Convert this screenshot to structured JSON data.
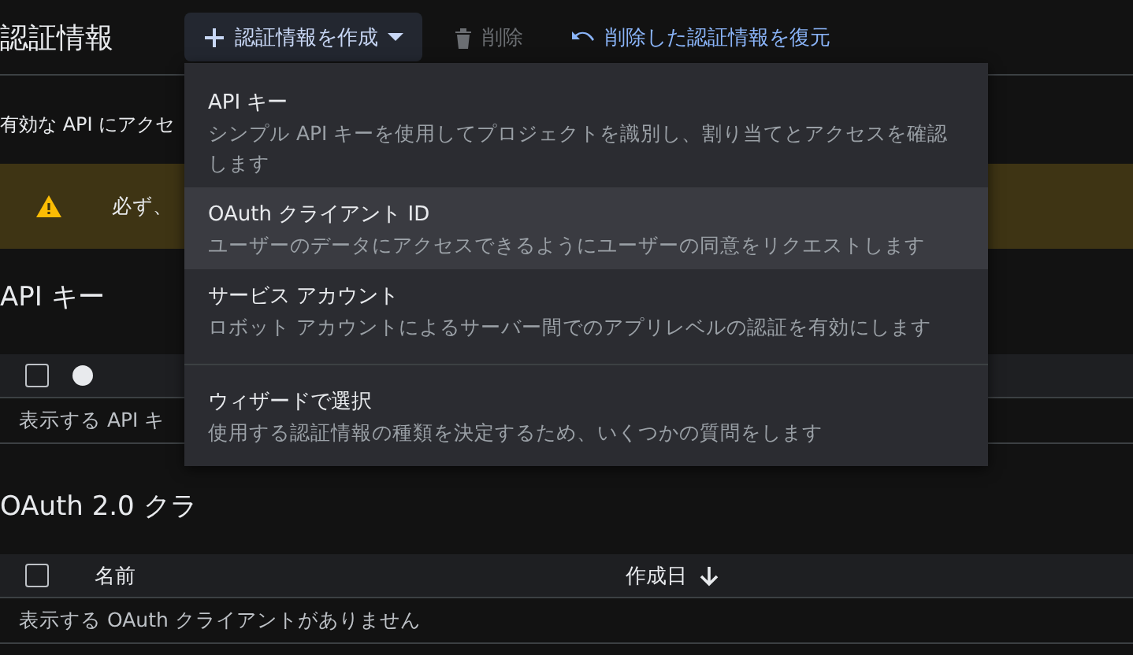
{
  "header": {
    "title": "認証情報",
    "create_button": "認証情報を作成",
    "delete_button": {
      "label": "削除",
      "disabled": true
    },
    "restore_link": "削除した認証情報を復元"
  },
  "intro": "有効な API にアクセ",
  "warning": "必ず、",
  "api_keys": {
    "heading": "API キー",
    "select_all_checked": false,
    "empty": "表示する API キ"
  },
  "oauth": {
    "heading": "OAuth 2.0 クラ",
    "select_all_checked": false,
    "columns": [
      "名前",
      "作成日"
    ],
    "empty": "表示する OAuth クライアントがありません"
  },
  "menu": {
    "items": [
      {
        "title": "API キー",
        "description": "シンプル API キーを使用してプロジェクトを識別し、割り当てとアクセスを確認します",
        "highlighted": false
      },
      {
        "title": "OAuth クライアント ID",
        "description": "ユーザーのデータにアクセスできるようにユーザーの同意をリクエストします",
        "highlighted": true
      },
      {
        "title": "サービス アカウント",
        "description": "ロボット アカウントによるサーバー間でのアプリレベルの認証を有効にします",
        "highlighted": false
      },
      {
        "title": "ウィザードで選択",
        "description": "使用する認証情報の種類を決定するため、いくつかの質問をします",
        "highlighted": false
      }
    ]
  }
}
